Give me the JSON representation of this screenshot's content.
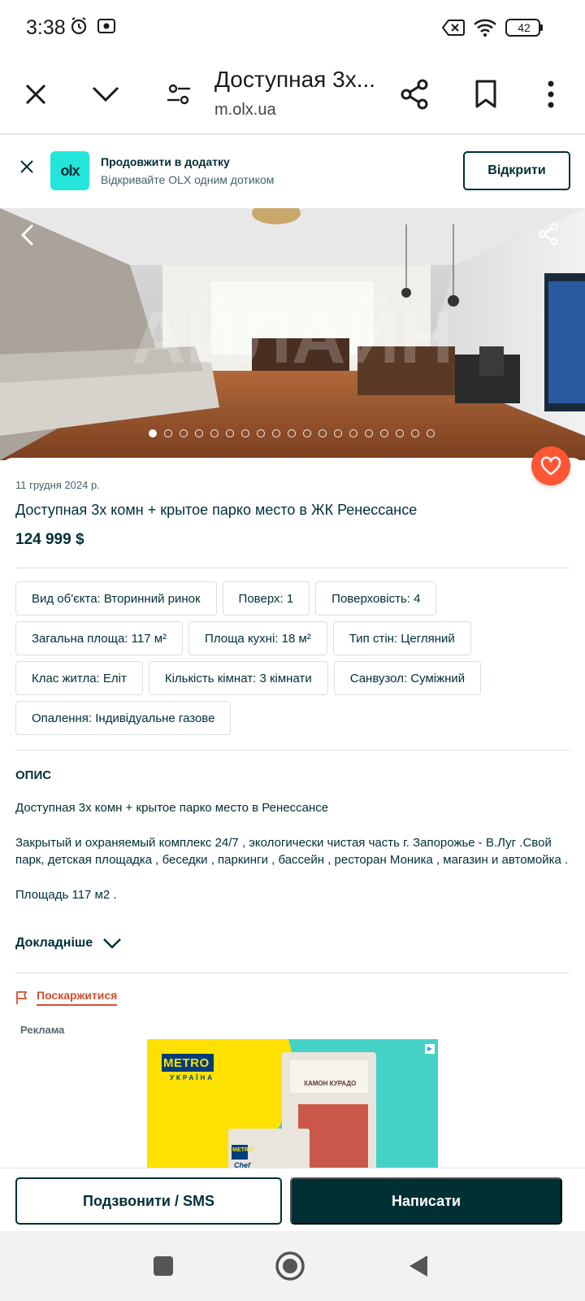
{
  "status_bar": {
    "time": "3:38",
    "battery": "42"
  },
  "browser": {
    "title": "Доступная 3х...",
    "url": "m.olx.ua",
    "icons": [
      "close-icon",
      "chevron-down-icon",
      "tune-icon",
      "share-icon",
      "bookmark-icon",
      "more-vert-icon"
    ]
  },
  "app_banner": {
    "logo_text": "olx",
    "title": "Продовжити в додатку",
    "subtitle": "Відкривайте OLX одним дотиком",
    "open_label": "Відкрити"
  },
  "gallery": {
    "dot_count": 19,
    "active_index": 0
  },
  "listing": {
    "date": "11 грудня 2024 р.",
    "title": "Доступная 3х комн + крытое парко место в ЖК Ренессансе",
    "price": "124 999 $",
    "params": [
      "Вид об'єкта: Вторинний ринок",
      "Поверх: 1",
      "Поверховість: 4",
      "Загальна площа: 117 м²",
      "Площа кухні: 18 м²",
      "Тип стін: Цегляний",
      "Клас житла: Еліт",
      "Кількість кімнат: 3 кімнати",
      "Санвузол: Суміжний",
      "Опалення: Індивідуальне газове"
    ],
    "description_heading": "ОПИС",
    "description": [
      "Доступная 3х комн + крытое парко место в Ренессансе",
      "Закрытый и охраняемый комплекс 24/7 , экологически чистая часть г. Запорожье - В.Луг .Свой парк, детская площадка , беседки , паркинги , бассейн , ресторан Моника , магазин и автомойка .",
      "Площадь 117 м2 ."
    ],
    "more_label": "Докладніше",
    "report_label": "Поскаржитися",
    "ad_label": "Реклама"
  },
  "ad": {
    "brand": "METRO",
    "brand_sub": "УКРАЇНА",
    "product": "ХАМОН КУРАДО",
    "brand2": "METRO",
    "chef": "Chef"
  },
  "actions": {
    "call_label": "Подзвонити / SMS",
    "message_label": "Написати"
  },
  "colors": {
    "primary": "#002f34",
    "accent": "#23e5db",
    "favorite": "#ff5636",
    "report": "#d14f2e"
  }
}
